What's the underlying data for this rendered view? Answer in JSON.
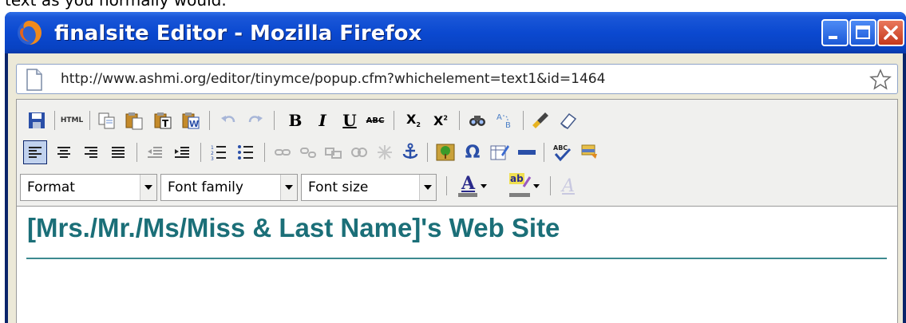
{
  "window": {
    "title": "finalsite Editor - Mozilla Firefox",
    "titlebar_color": "#0b49d0",
    "close_color": "#c4381c"
  },
  "urlbar": {
    "url": "http://www.ashmi.org/editor/tinymce/popup.cfm?whichelement=text1&id=1464"
  },
  "toolbar": {
    "row1_icons": [
      "save-icon",
      "html-source-icon",
      "copy-icon",
      "paste-icon",
      "paste-text-icon",
      "paste-word-icon",
      "undo-icon",
      "redo-icon",
      "bold-icon",
      "italic-icon",
      "underline-icon",
      "strikethrough-icon",
      "subscript-icon",
      "superscript-icon",
      "find-icon",
      "replace-icon",
      "cleanup-icon",
      "eraser-icon"
    ],
    "html_label": "HTML",
    "bold": "B",
    "italic": "I",
    "underline": "U",
    "strike": "ABC",
    "subscript": "X",
    "superscript": "X",
    "row2_icons": [
      "align-left-icon",
      "align-center-icon",
      "align-right-icon",
      "align-justify-icon",
      "outdent-icon",
      "indent-icon",
      "numbered-list-icon",
      "bullet-list-icon",
      "link-icon",
      "unlink-icon",
      "image-icon",
      "media-icon",
      "flash-icon",
      "anchor-icon",
      "insert-image-icon",
      "special-char-icon",
      "table-icon",
      "horizontal-rule-icon",
      "spellcheck-icon",
      "template-icon"
    ],
    "omega": "Ω",
    "format_select": "Format",
    "font_family_select": "Font family",
    "font_size_select": "Font size",
    "text_color_glyph": "A",
    "highlight_glyph": "ab",
    "style_glyph": "A"
  },
  "content": {
    "heading": "[Mrs./Mr./Ms/Miss & Last Name]'s Web Site",
    "heading_color": "#1b6f78"
  }
}
